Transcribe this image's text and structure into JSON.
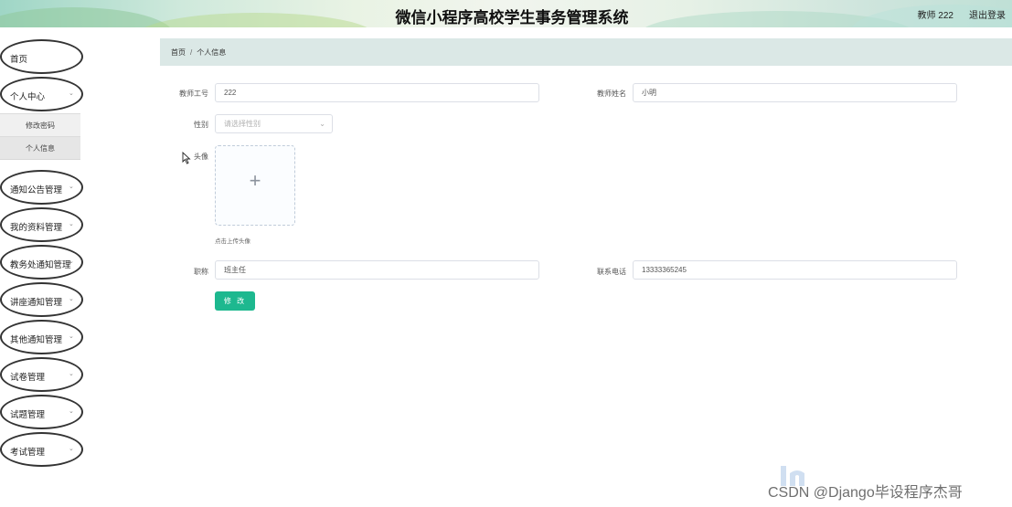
{
  "header": {
    "title": "微信小程序高校学生事务管理系统",
    "user_text": "教师 222",
    "logout_label": "退出登录"
  },
  "sidebar": {
    "items": [
      {
        "label": "首页",
        "has_arrow": false
      },
      {
        "label": "个人中心",
        "has_arrow": true,
        "expanded": true,
        "children": [
          {
            "label": "修改密码"
          },
          {
            "label": "个人信息",
            "active": true
          }
        ]
      },
      {
        "label": "通知公告管理",
        "has_arrow": true
      },
      {
        "label": "我的资料管理",
        "has_arrow": true
      },
      {
        "label": "教务处通知管理",
        "has_arrow": true
      },
      {
        "label": "讲座通知管理",
        "has_arrow": true
      },
      {
        "label": "其他通知管理",
        "has_arrow": true
      },
      {
        "label": "试卷管理",
        "has_arrow": true
      },
      {
        "label": "试题管理",
        "has_arrow": true
      },
      {
        "label": "考试管理",
        "has_arrow": true
      }
    ]
  },
  "breadcrumb": {
    "home": "首页",
    "separator": "/",
    "current": "个人信息"
  },
  "form": {
    "teacher_id_label": "教师工号",
    "teacher_id_value": "222",
    "teacher_name_label": "教师姓名",
    "teacher_name_value": "小明",
    "gender_label": "性别",
    "gender_placeholder": "请选择性别",
    "avatar_label": "头像",
    "upload_tip": "点击上传头像",
    "title_label": "职称",
    "title_value": "班主任",
    "phone_label": "联系电话",
    "phone_value": "13333365245",
    "submit_label": "修 改"
  },
  "colors": {
    "accent_button": "#1db88f",
    "breadcrumb_bg": "#dbe8e6"
  },
  "watermark": "CSDN @Django毕设程序杰哥"
}
